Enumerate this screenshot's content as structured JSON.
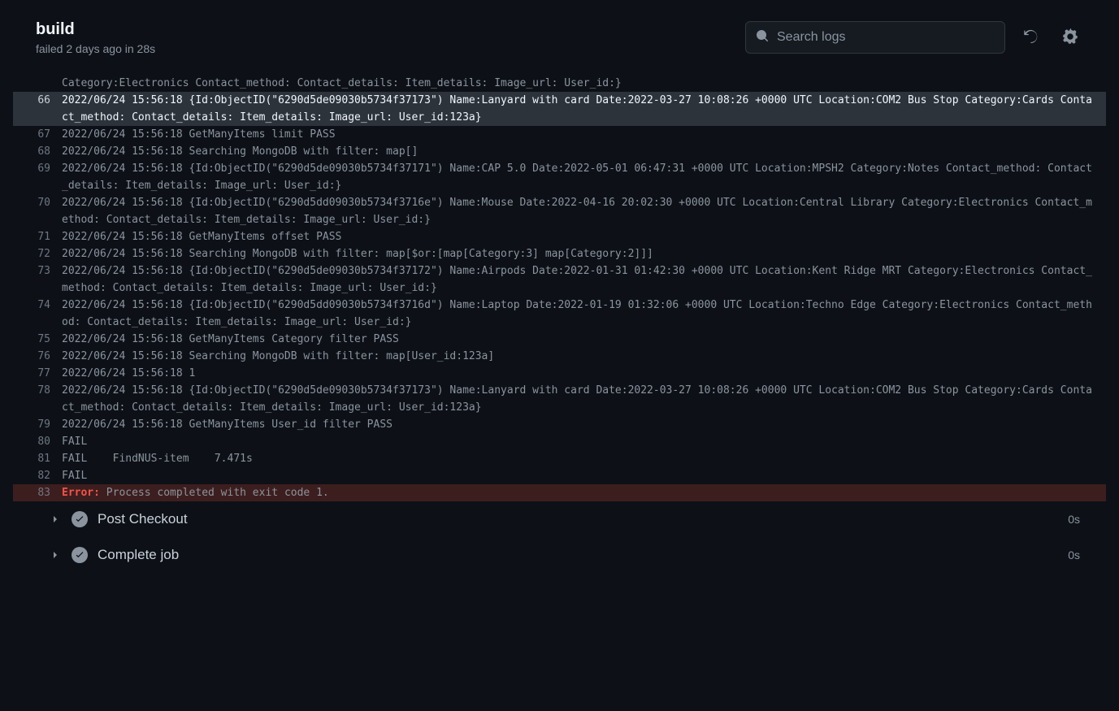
{
  "header": {
    "title": "build",
    "subtitle": "failed 2 days ago in 28s"
  },
  "search": {
    "placeholder": "Search logs"
  },
  "log": {
    "partial_first": "Category:Electronics Contact_method: Contact_details: Item_details: Image_url: User_id:}",
    "lines": [
      {
        "num": "66",
        "highlight": true,
        "text": "2022/06/24 15:56:18 {Id:ObjectID(\"6290d5de09030b5734f37173\") Name:Lanyard with card Date:2022-03-27 10:08:26 +0000 UTC Location:COM2 Bus Stop Category:Cards Contact_method: Contact_details: Item_details: Image_url: User_id:123a}"
      },
      {
        "num": "67",
        "text": "2022/06/24 15:56:18 GetManyItems limit PASS"
      },
      {
        "num": "68",
        "text": "2022/06/24 15:56:18 Searching MongoDB with filter: map[]"
      },
      {
        "num": "69",
        "text": "2022/06/24 15:56:18 {Id:ObjectID(\"6290d5de09030b5734f37171\") Name:CAP 5.0 Date:2022-05-01 06:47:31 +0000 UTC Location:MPSH2 Category:Notes Contact_method: Contact_details: Item_details: Image_url: User_id:}"
      },
      {
        "num": "70",
        "text": "2022/06/24 15:56:18 {Id:ObjectID(\"6290d5dd09030b5734f3716e\") Name:Mouse Date:2022-04-16 20:02:30 +0000 UTC Location:Central Library Category:Electronics Contact_method: Contact_details: Item_details: Image_url: User_id:}"
      },
      {
        "num": "71",
        "text": "2022/06/24 15:56:18 GetManyItems offset PASS"
      },
      {
        "num": "72",
        "text": "2022/06/24 15:56:18 Searching MongoDB with filter: map[$or:[map[Category:3] map[Category:2]]]"
      },
      {
        "num": "73",
        "text": "2022/06/24 15:56:18 {Id:ObjectID(\"6290d5de09030b5734f37172\") Name:Airpods Date:2022-01-31 01:42:30 +0000 UTC Location:Kent Ridge MRT Category:Electronics Contact_method: Contact_details: Item_details: Image_url: User_id:}"
      },
      {
        "num": "74",
        "text": "2022/06/24 15:56:18 {Id:ObjectID(\"6290d5dd09030b5734f3716d\") Name:Laptop Date:2022-01-19 01:32:06 +0000 UTC Location:Techno Edge Category:Electronics Contact_method: Contact_details: Item_details: Image_url: User_id:}"
      },
      {
        "num": "75",
        "text": "2022/06/24 15:56:18 GetManyItems Category filter PASS"
      },
      {
        "num": "76",
        "text": "2022/06/24 15:56:18 Searching MongoDB with filter: map[User_id:123a]"
      },
      {
        "num": "77",
        "text": "2022/06/24 15:56:18 1"
      },
      {
        "num": "78",
        "text": "2022/06/24 15:56:18 {Id:ObjectID(\"6290d5de09030b5734f37173\") Name:Lanyard with card Date:2022-03-27 10:08:26 +0000 UTC Location:COM2 Bus Stop Category:Cards Contact_method: Contact_details: Item_details: Image_url: User_id:123a}"
      },
      {
        "num": "79",
        "text": "2022/06/24 15:56:18 GetManyItems User_id filter PASS"
      },
      {
        "num": "80",
        "text": "FAIL"
      },
      {
        "num": "81",
        "text": "FAIL    FindNUS-item    7.471s"
      },
      {
        "num": "82",
        "text": "FAIL"
      },
      {
        "num": "83",
        "error": true,
        "prefix": "Error:",
        "text": " Process completed with exit code 1."
      }
    ]
  },
  "steps": [
    {
      "name": "Post Checkout",
      "time": "0s"
    },
    {
      "name": "Complete job",
      "time": "0s"
    }
  ]
}
